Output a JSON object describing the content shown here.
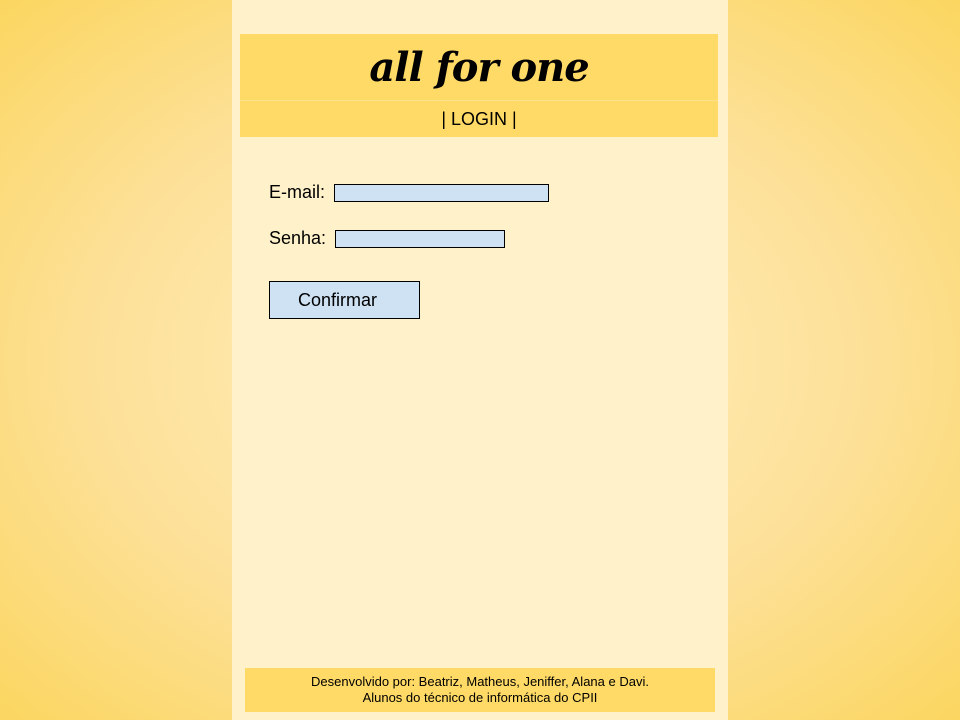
{
  "header": {
    "title": "all for one",
    "nav_login": "| LOGIN |"
  },
  "form": {
    "email_label": "E-mail:",
    "email_value": "",
    "password_label": "Senha:",
    "password_value": "",
    "confirm_label": "Confirmar"
  },
  "footer": {
    "line1": "Desenvolvido por: Beatriz, Matheus, Jeniffer, Alana e Davi.",
    "line2": "Alunos do técnico de informática do CPII"
  },
  "colors": {
    "background_edge": "#fbd660",
    "page_background": "#fff1ca",
    "header_background": "#ffda66",
    "input_background": "#cfe2f3"
  }
}
